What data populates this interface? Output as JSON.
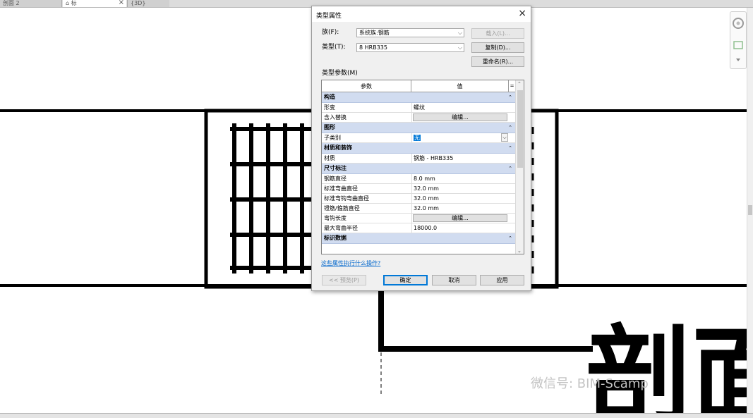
{
  "tabs": [
    {
      "label": "剖面 2",
      "active": false
    },
    {
      "label": "标",
      "active": true
    },
    {
      "label": "{3D}",
      "active": false
    }
  ],
  "watermark": "微信号: BIM-Scamp",
  "canvas_text": "剖面",
  "dialog": {
    "title": "类型属性",
    "family_label": "族(F):",
    "family_value": "系统族:钢筋",
    "type_label": "类型(T):",
    "type_value": "8 HRB335",
    "load_button": "载入(L)...",
    "duplicate_button": "复制(D)...",
    "rename_button": "重命名(R)...",
    "type_params_label": "类型参数(M)",
    "table": {
      "header_param": "参数",
      "header_value": "值",
      "header_extra": "=",
      "groups": [
        {
          "name": "构造",
          "rows": [
            {
              "param": "形变",
              "value": "螺纹",
              "kind": "text"
            },
            {
              "param": "含入替换",
              "value": "编辑...",
              "kind": "button"
            }
          ]
        },
        {
          "name": "图形",
          "rows": [
            {
              "param": "子类别",
              "value": "无",
              "kind": "dropdown"
            }
          ]
        },
        {
          "name": "材质和装饰",
          "rows": [
            {
              "param": "材质",
              "value": "钢筋 - HRB335",
              "kind": "text"
            }
          ]
        },
        {
          "name": "尺寸标注",
          "rows": [
            {
              "param": "钢筋直径",
              "value": "8.0 mm",
              "kind": "text"
            },
            {
              "param": "标准弯曲直径",
              "value": "32.0 mm",
              "kind": "text"
            },
            {
              "param": "标准弯钩弯曲直径",
              "value": "32.0 mm",
              "kind": "text"
            },
            {
              "param": "镫筋/箍筋直径",
              "value": "32.0 mm",
              "kind": "text"
            },
            {
              "param": "弯钩长度",
              "value": "编辑...",
              "kind": "button"
            },
            {
              "param": "最大弯曲半径",
              "value": "18000.0",
              "kind": "text"
            }
          ]
        },
        {
          "name": "标识数据",
          "rows": []
        }
      ]
    },
    "help_link": "这些属性执行什么操作?",
    "preview_button": "<< 预览(P)",
    "ok_button": "确定",
    "cancel_button": "取消",
    "apply_button": "应用"
  }
}
